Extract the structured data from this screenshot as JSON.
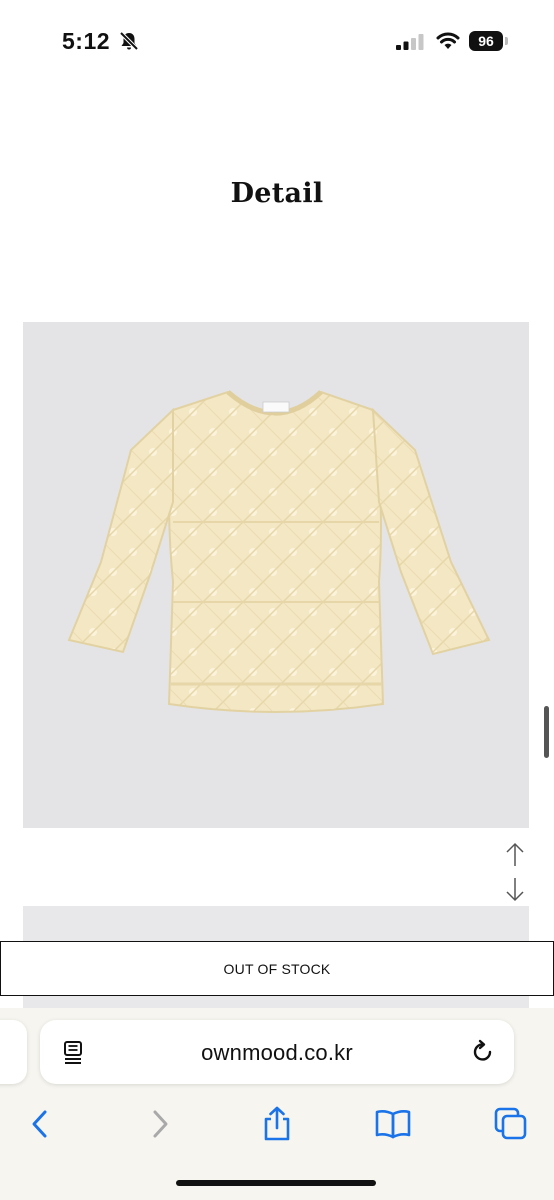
{
  "status_bar": {
    "time": "5:12",
    "battery": "96",
    "icons": [
      "bell-slash-icon",
      "signal-icon",
      "wifi-icon",
      "battery-icon"
    ]
  },
  "page": {
    "title": "Detail"
  },
  "product": {
    "image_icon": "knit-sweater-image",
    "scroll_up_icon": "arrow-up-icon",
    "scroll_down_icon": "arrow-down-icon"
  },
  "stock_button": {
    "label": "OUT OF STOCK"
  },
  "browser": {
    "url": "ownmood.co.kr",
    "icons": [
      "reader-icon",
      "reload-icon",
      "back-icon",
      "forward-icon",
      "share-icon",
      "bookmarks-icon",
      "tabs-icon"
    ]
  },
  "colors": {
    "accent": "#1a73e8",
    "background": "#ffffff",
    "sweater": "#f4e9c8",
    "image_bg": "#e4e4e6",
    "browser_bar": "#f6f5ef"
  }
}
